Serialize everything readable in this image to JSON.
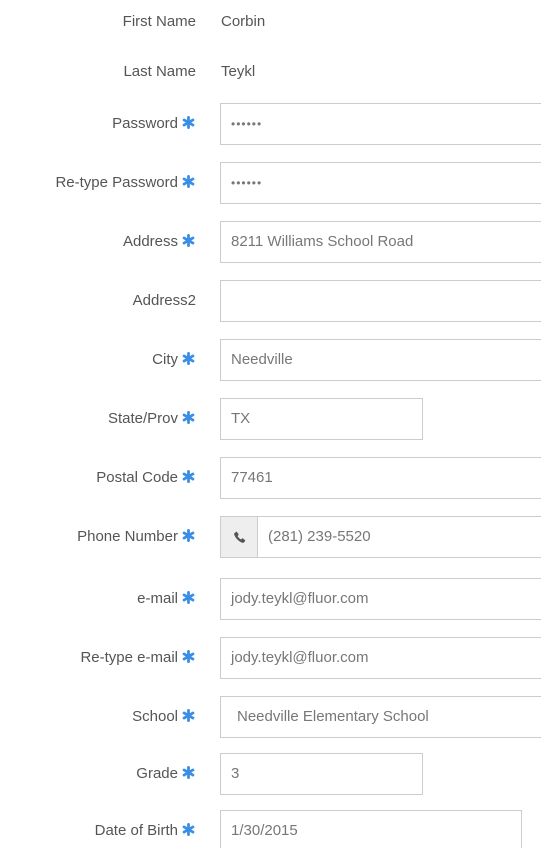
{
  "form": {
    "first_name": {
      "label": "First Name",
      "value": "Corbin"
    },
    "last_name": {
      "label": "Last Name",
      "value": "Teykl"
    },
    "password": {
      "label": "Password",
      "value": "••••••"
    },
    "retype_password": {
      "label": "Re-type Password",
      "value": "••••••"
    },
    "address": {
      "label": "Address",
      "value": "8211 Williams School Road"
    },
    "address2": {
      "label": "Address2",
      "value": ""
    },
    "city": {
      "label": "City",
      "value": "Needville"
    },
    "state": {
      "label": "State/Prov",
      "value": "TX"
    },
    "postal_code": {
      "label": "Postal Code",
      "value": "77461"
    },
    "phone": {
      "label": "Phone Number",
      "value": "(281) 239-5520",
      "icon": "phone-icon"
    },
    "email": {
      "label": "e-mail",
      "value": "jody.teykl@fluor.com"
    },
    "retype_email": {
      "label": "Re-type e-mail",
      "value": "jody.teykl@fluor.com"
    },
    "school": {
      "label": "School",
      "value": "Needville Elementary School"
    },
    "grade": {
      "label": "Grade",
      "value": "3"
    },
    "dob": {
      "label": "Date of Birth",
      "value": "1/30/2015"
    }
  },
  "colors": {
    "required_marker": "#3a8ee6",
    "label_text": "#555555",
    "field_border": "#cccccc",
    "addon_background": "#eeeeee"
  },
  "icons": {
    "required": "asterisk-icon",
    "phone": "phone-icon"
  }
}
